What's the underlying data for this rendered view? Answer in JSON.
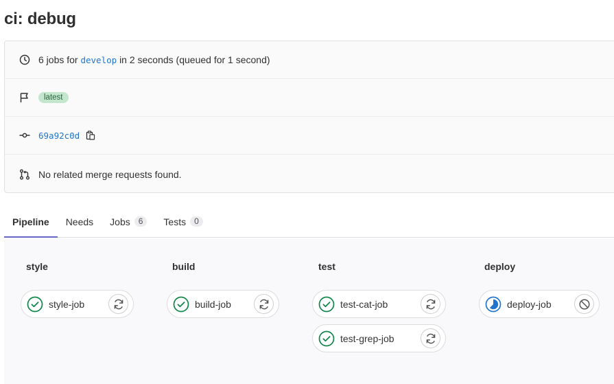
{
  "page": {
    "title": "ci: debug"
  },
  "info": {
    "jobs_prefix": "6 jobs for",
    "branch": "develop",
    "duration_text": "in 2 seconds (queued for 1 second)",
    "badge": "latest",
    "commit_sha": "69a92c0d",
    "merge_requests": "No related merge requests found."
  },
  "tabs": [
    {
      "label": "Pipeline",
      "count": null
    },
    {
      "label": "Needs",
      "count": null
    },
    {
      "label": "Jobs",
      "count": "6"
    },
    {
      "label": "Tests",
      "count": "0"
    }
  ],
  "stages": [
    {
      "name": "style",
      "jobs": [
        {
          "name": "style-job",
          "status": "success",
          "action": "retry"
        }
      ]
    },
    {
      "name": "build",
      "jobs": [
        {
          "name": "build-job",
          "status": "success",
          "action": "retry"
        }
      ]
    },
    {
      "name": "test",
      "jobs": [
        {
          "name": "test-cat-job",
          "status": "success",
          "action": "retry"
        },
        {
          "name": "test-grep-job",
          "status": "success",
          "action": "retry"
        }
      ]
    },
    {
      "name": "deploy",
      "jobs": [
        {
          "name": "deploy-job",
          "status": "running",
          "action": "cancel"
        }
      ]
    }
  ],
  "colors": {
    "success": "#108548",
    "running": "#1f75cb",
    "link": "#1f75cb",
    "tab_accent": "#6666c4"
  }
}
